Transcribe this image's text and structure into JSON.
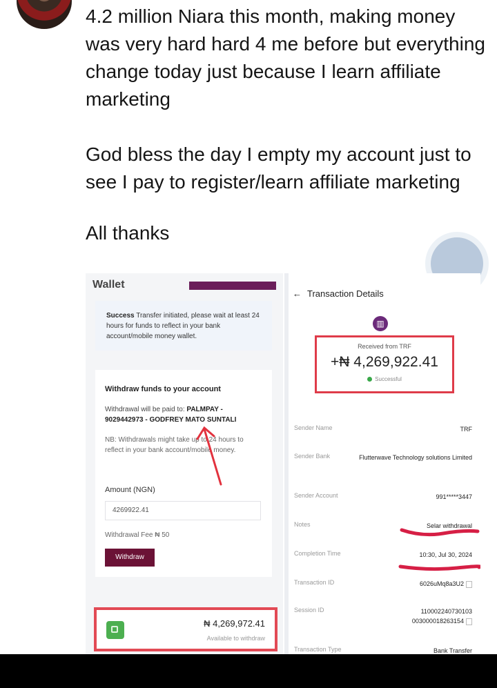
{
  "post": {
    "paragraph1": "4.2 million Niara this month, making money was very hard hard 4 me before but everything change today just because I learn affiliate marketing",
    "paragraph2": "God bless the day I empty my account just to see I pay to register/learn affiliate marketing",
    "paragraph3": "All thanks"
  },
  "wallet": {
    "title": "Wallet",
    "success_label": "Success",
    "success_text": "Transfer initiated, please wait at least 24 hours for funds to reflect in your bank account/mobile money wallet.",
    "withdraw_title": "Withdraw funds to your account",
    "paid_to_label": "Withdrawal will be paid to:",
    "paid_to_value": "PALMPAY - 9029442973 - GODFREY MATO SUNTALI",
    "note": "NB: Withdrawals might take up to 24 hours to reflect in your bank account/mobile money.",
    "amount_label": "Amount (NGN)",
    "amount_value": "4269922.41",
    "fee": "Withdrawal Fee ₦ 50",
    "withdraw_button": "Withdraw",
    "balance": "₦ 4,269,972.41",
    "balance_caption": "Available to withdraw"
  },
  "transaction": {
    "header": "Transaction Details",
    "received_from": "Received from TRF",
    "amount": "+₦ 4,269,922.41",
    "status": "Successful",
    "rows": [
      {
        "label": "Sender Name",
        "value": "TRF"
      },
      {
        "label": "Sender Bank",
        "value": "Flutterwave Technology solutions Limited"
      },
      {
        "label": "Sender Account",
        "value": "991*****3447"
      },
      {
        "label": "Notes",
        "value": "Selar withdrawal"
      },
      {
        "label": "Completion Time",
        "value": "10:30, Jul 30, 2024"
      },
      {
        "label": "Transaction ID",
        "value": "6026uMq8a3U2"
      },
      {
        "label": "Session ID",
        "value": "110002240730103 003000018263154"
      },
      {
        "label": "Transaction Type",
        "value": "Bank Transfer"
      }
    ]
  },
  "colors": {
    "accent_red": "#df3b49",
    "brand_purple": "#6b1236",
    "success_green": "#39a849"
  },
  "icons": [
    "avatar",
    "bank-icon",
    "wallet-icon",
    "back-arrow-icon",
    "copy-icon",
    "success-dot-icon"
  ]
}
